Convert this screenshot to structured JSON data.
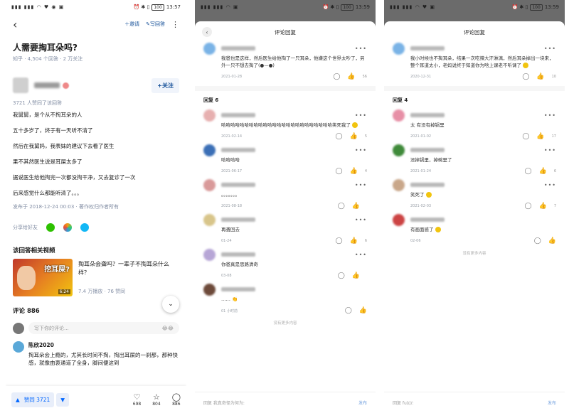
{
  "status_time": "13:57",
  "status_time_dark": "13:59",
  "battery": "100",
  "panel1": {
    "top": {
      "invite": "邀请",
      "write": "写回答"
    },
    "question": {
      "title": "人需要掏耳朵吗?",
      "meta": "知乎 · 4,504 个回答 · 2 万关注"
    },
    "follow_label": "+关注",
    "agree_note": "3721 人赞同了该回答",
    "answer": [
      "我舅舅，是个从不掏耳朵的人",
      "五十多岁了，终于有一天听不清了",
      "然后在我舅妈，我表妹的建议下去看了医生",
      "果不其然医生说是耳屎太多了",
      "据说医生给他掏完一次都没掏干净，又去复诊了一次",
      "后来感觉什么都能听清了。。。"
    ],
    "published": "发布于 2018-12-24 00:03 · 著作权归作者所有",
    "share_label": "分享给好友",
    "related_title": "该回答相关视频",
    "video": {
      "caption": "挖耳屎?",
      "duration": "6:24",
      "title": "掏耳朵会聋吗？一辈子不掏耳朵什么样？",
      "meta": "7.4 万播放 · 76 赞同"
    },
    "comments_title": "评论 886",
    "comment_placeholder": "写下你的评论...",
    "first_comment": {
      "name": "陈欣2020",
      "text": "掏耳朵会上瘾的，尤其长时间不掏，掏出耳屎的一刹那，那种快感，就像由衷通道了全身，脚间便这到"
    },
    "bottom": {
      "vote": "赞同 3721",
      "stat1": "698",
      "stat2": "804",
      "stat3": "886"
    }
  },
  "panel2": {
    "sheet_title": "评论回复",
    "root": {
      "text": "我爸也是这样，然后医生给他掏了一只耳朵，他嫌这个世界太吵了，另外一只不想去掏了(●—●)",
      "date": "2021-01-28",
      "likes": "56"
    },
    "reply_count_label": "回复 6",
    "replies": [
      {
        "text": "哈哈哈哈哈哈哈哈哈哈哈哈哈哈哈哈哈哈哈哈哈哈哈哈笑死我了",
        "date": "2021-02-14",
        "likes": "5"
      },
      {
        "text": "哈哈哈哈",
        "date": "2021-06-17",
        "likes": "4"
      },
      {
        "text": "。。。。。。。",
        "date": "2021-08-18",
        "likes": ""
      },
      {
        "text": "再聋回去",
        "date": "01-24",
        "likes": "6"
      },
      {
        "text": "你爸真是思路清奇",
        "date": "03-08",
        "likes": ""
      },
      {
        "text": "……",
        "date": "01 小时前",
        "likes": ""
      }
    ],
    "no_more": "没有更多内容",
    "input_placeholder": "回复 我真奇怪为何为:",
    "send_label": "发布"
  },
  "panel3": {
    "sheet_title": "评论回复",
    "root": {
      "text": "我小时候也不掏耳朵，结果一次吃辣大汗淋漓，然后耳朵掉出一块来，整个耳道太小，老妈说终于知道你为啥上课老不听课了",
      "date": "2020-12-31",
      "likes": "10"
    },
    "reply_count_label": "回复 4",
    "replies": [
      {
        "text": "太 有没有掉锅里",
        "date": "2021-01-02",
        "likes": "17"
      },
      {
        "text": "没掉锅里，掉碗里了",
        "date": "2021-01-24",
        "likes": "6"
      },
      {
        "text": "笑死了",
        "date": "2021-02-03",
        "likes": "7"
      },
      {
        "text": "有画面感了",
        "date": "02-06",
        "likes": ""
      }
    ],
    "no_more": "没有更多内容",
    "input_placeholder": "回复 ful///:",
    "send_label": "发布"
  },
  "colors": {
    "brand": "#0066ff",
    "link": "#175199",
    "meta": "#8590a6"
  }
}
